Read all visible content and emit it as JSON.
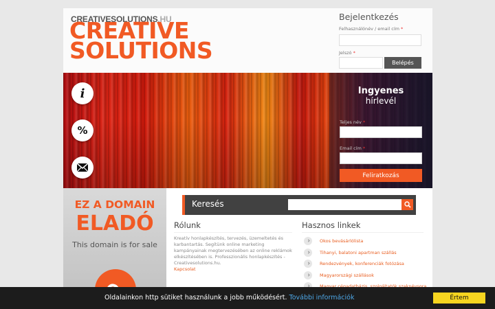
{
  "header": {
    "logo_small_main": "CREATIVESOLUTIONS",
    "logo_small_tld": ".HU",
    "logo_line1": "CREATIVE",
    "logo_line2": "SOLUTIONS"
  },
  "login": {
    "title": "Bejelentkezés",
    "username_label": "Felhasználónév / email cím",
    "password_label": "Jelszó",
    "required_mark": "*",
    "button": "Belépés"
  },
  "banner": {
    "icons": [
      "info-icon",
      "percent-icon",
      "mail-icon"
    ],
    "info_glyph": "i",
    "percent_glyph": "%"
  },
  "newsletter": {
    "title": "Ingyenes",
    "subtitle": "hírlevél",
    "name_label": "Teljes név",
    "email_label": "Email cím",
    "required_mark": "*",
    "button": "Feliratkozás"
  },
  "sale": {
    "line1": "EZ A DOMAIN",
    "line2": "ELADÓ",
    "line3": "This domain is for sale"
  },
  "search": {
    "label": "Keresés"
  },
  "about": {
    "title": "Rólunk",
    "text": "Kreatív honlapkészítés, tervezés, üzemeltetés és karbantartás. Segítünk online marketing kampányainak megtervezésében az online reklámok elkészítésében is. Professzionális honlapkészítés - Creativesolutions.hu.",
    "link": "Kapcsolat"
  },
  "links": {
    "title": "Hasznos linkek",
    "items": [
      "Okos bevásárlólista",
      "Tihanyi, balatoni apartman szállás",
      "Rendezvények, konferenciák fotózása",
      "Magyarországi szállások",
      "Magyar cégadatbázis, szolgáltatók szaknévsora"
    ]
  },
  "cookie": {
    "text": "Oldalainkon http sütiket használunk a jobb működésért.",
    "link": "További információk",
    "button": "Értem"
  },
  "colors": {
    "accent": "#f15a24",
    "dark": "#414141",
    "cookie_button": "#f7d520"
  }
}
